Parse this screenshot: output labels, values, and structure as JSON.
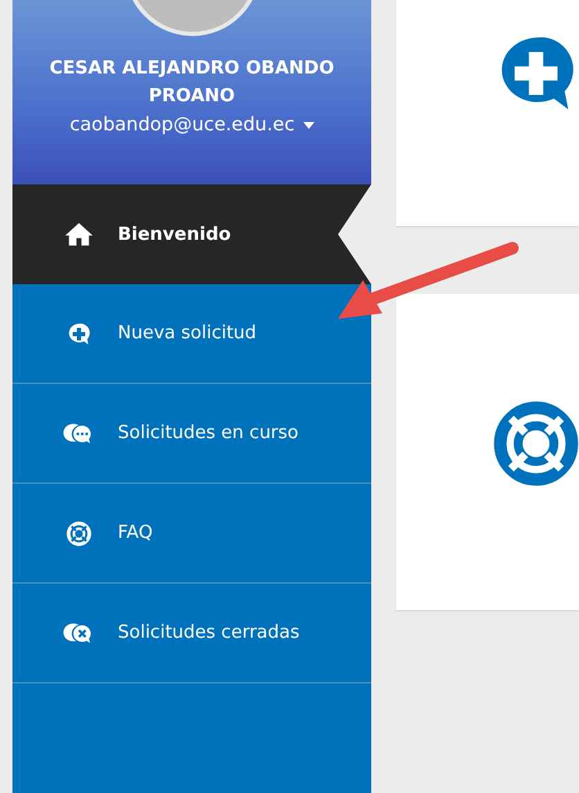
{
  "profile": {
    "name": "CESAR ALEJANDRO OBANDO PROANO",
    "email": "caobandop@uce.edu.ec"
  },
  "menu": [
    {
      "label": "Bienvenido",
      "kind": "home",
      "selected": true
    },
    {
      "label": "Nueva solicitud",
      "kind": "new",
      "selected": false
    },
    {
      "label": "Solicitudes en curso",
      "kind": "chats",
      "selected": false
    },
    {
      "label": "FAQ",
      "kind": "help",
      "selected": false
    },
    {
      "label": "Solicitudes cerradas",
      "kind": "closed",
      "selected": false
    }
  ],
  "cards": [
    {
      "kind": "new"
    },
    {
      "kind": "help"
    }
  ]
}
